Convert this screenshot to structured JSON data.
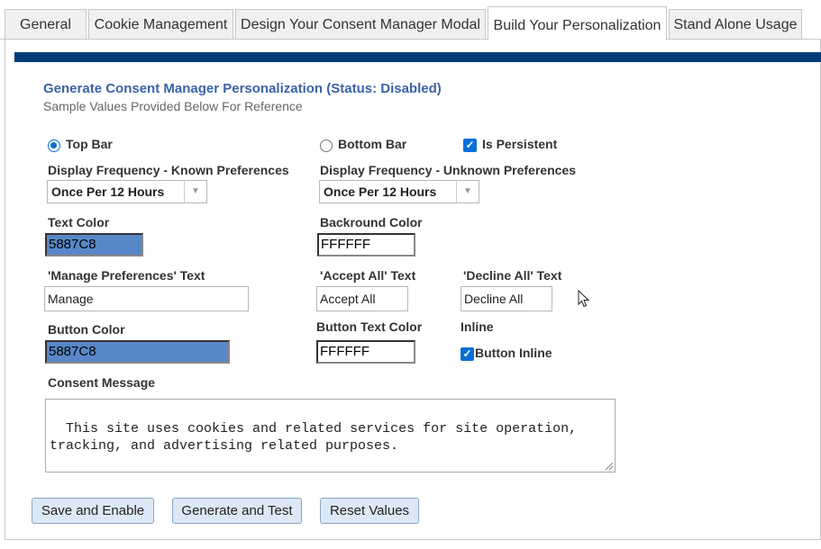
{
  "tabs": [
    {
      "label": "General"
    },
    {
      "label": "Cookie Management"
    },
    {
      "label": "Design Your Consent Manager Modal"
    },
    {
      "label": "Build Your Personalization"
    },
    {
      "label": "Stand Alone Usage"
    }
  ],
  "header": {
    "title": "Generate Consent Manager Personalization (Status: Disabled)",
    "subtitle": "Sample Values Provided Below For Reference"
  },
  "position": {
    "top_bar": "Top Bar",
    "bottom_bar": "Bottom Bar",
    "selected": "Top Bar"
  },
  "persistent": {
    "label": "Is Persistent",
    "checked": true
  },
  "freq_known": {
    "label": "Display Frequency - Known Preferences",
    "value": "Once Per 12 Hours"
  },
  "freq_unknown": {
    "label": "Display Frequency - Unknown Preferences",
    "value": "Once Per 12 Hours"
  },
  "text_color": {
    "label": "Text Color",
    "value": "5887C8"
  },
  "background_color": {
    "label": "Backround Color",
    "value": "FFFFFF"
  },
  "manage_text": {
    "label": "'Manage Preferences' Text",
    "value": "Manage"
  },
  "accept_text": {
    "label": "'Accept All' Text",
    "value": "Accept All"
  },
  "decline_text": {
    "label": "'Decline All' Text",
    "value": "Decline All"
  },
  "button_color": {
    "label": "Button Color",
    "value": "5887C8"
  },
  "button_text_color": {
    "label": "Button Text Color",
    "value": "FFFFFF"
  },
  "inline": {
    "label": "Inline",
    "checkbox_label": "Button Inline",
    "checked": true
  },
  "consent": {
    "label": "Consent Message",
    "value": "This site uses cookies and related services for site operation,\ntracking, and advertising related purposes."
  },
  "buttons": {
    "save": "Save and Enable",
    "generate": "Generate and Test",
    "reset": "Reset Values"
  },
  "colors": {
    "accent": "#3a63a7",
    "band": "#003d79",
    "swatch": "#5887c8",
    "check": "#0b6fd8"
  }
}
